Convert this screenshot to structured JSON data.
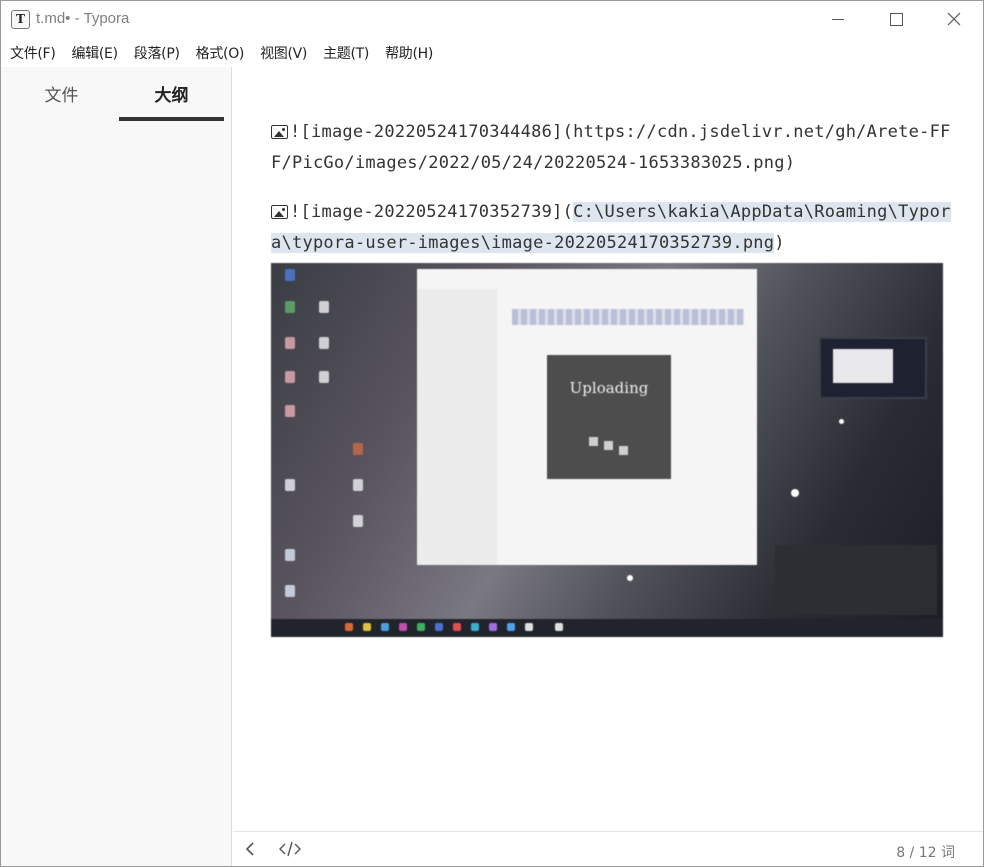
{
  "window": {
    "app_icon_letter": "T",
    "title": "t.md• - Typora"
  },
  "menu": [
    {
      "label": "文件(F)"
    },
    {
      "label": "编辑(E)"
    },
    {
      "label": "段落(P)"
    },
    {
      "label": "格式(O)"
    },
    {
      "label": "视图(V)"
    },
    {
      "label": "主题(T)"
    },
    {
      "label": "帮助(H)"
    }
  ],
  "sidebar": {
    "tabs": [
      {
        "label": "文件",
        "active": false
      },
      {
        "label": "大纲",
        "active": true
      }
    ]
  },
  "editor": {
    "line1": {
      "prefix": "![image-20220524170344486](",
      "url": "https://cdn.jsdelivr.net/gh/Arete-FFF/PicGo/images/2022/05/24/20220524-1653383025.png",
      "suffix": ")"
    },
    "line2": {
      "prefix": "![image-20220524170352739](",
      "path": "C:\\Users\\kakia\\AppData\\Roaming\\Typora\\typora-user-images\\image-20220524170352739.png",
      "suffix": ")"
    },
    "upload_overlay": {
      "text": "Uploading",
      "overlay_color": "#4d4d4d"
    }
  },
  "statusbar": {
    "back_icon": "chevron-left-icon",
    "source_icon": "code-icon",
    "word_count": "8 / 12 词"
  },
  "colors": {
    "selection": "#dde5ee",
    "active_tab_underline": "#333333"
  }
}
